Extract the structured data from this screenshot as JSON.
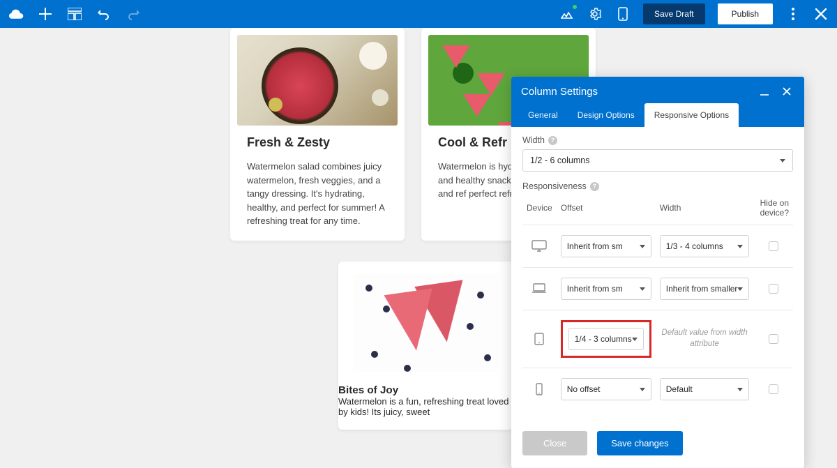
{
  "toolbar": {
    "save_draft": "Save Draft",
    "publish": "Publish"
  },
  "cards": {
    "c1": {
      "title": "Fresh & Zesty",
      "body": "Watermelon salad combines juicy watermelon, fresh veggies, and a tangy dressing. It's hydrating, healthy, and perfect for summer! A refreshing treat for any time."
    },
    "c2": {
      "title": "Cool & Refr",
      "body": "Watermelon is hyd with vitamins, and healthy snack. It h nourishes, and ref perfect refreshme"
    },
    "c3": {
      "title": "Bites of Joy",
      "body": "Watermelon is a fun, refreshing treat loved by kids! Its juicy, sweet"
    }
  },
  "dialog": {
    "title": "Column Settings",
    "tabs": {
      "general": "General",
      "design": "Design Options",
      "responsive": "Responsive Options"
    },
    "width_label": "Width",
    "width_value": "1/2 - 6 columns",
    "responsiveness_label": "Responsiveness",
    "headers": {
      "device": "Device",
      "offset": "Offset",
      "width": "Width",
      "hide": "Hide on device?"
    },
    "rows": {
      "desktop": {
        "offset": "Inherit from sm",
        "width": "1/3 - 4 columns"
      },
      "laptop": {
        "offset": "Inherit from sm",
        "width": "Inherit from smaller"
      },
      "tablet": {
        "offset": "1/4 - 3 columns",
        "width_hint": "Default value from width attribute"
      },
      "phone": {
        "offset": "No offset",
        "width": "Default"
      }
    },
    "close": "Close",
    "save": "Save changes"
  }
}
